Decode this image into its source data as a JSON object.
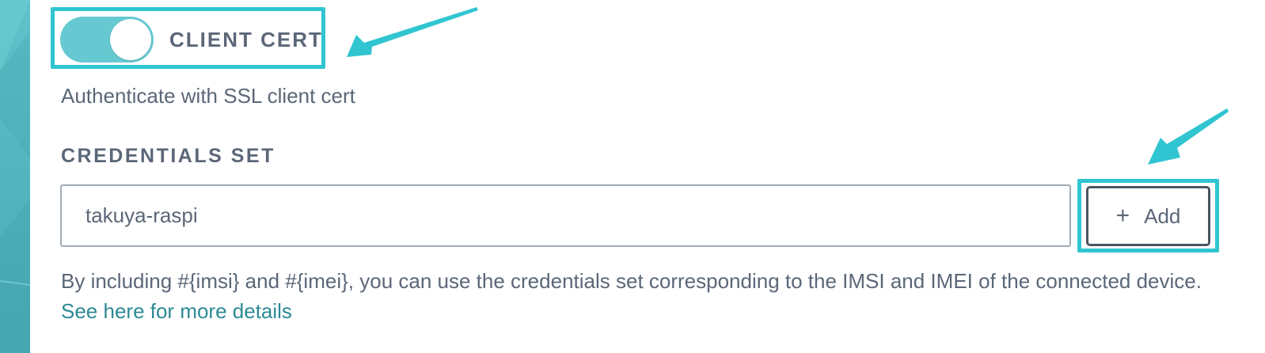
{
  "client_cert": {
    "label": "CLIENT CERT",
    "enabled": true,
    "description": "Authenticate with SSL client cert"
  },
  "credentials_set": {
    "title": "CREDENTIALS SET",
    "input_value": "takuya-raspi",
    "add_button_label": "Add",
    "help_text": "By including #{imsi} and #{imei}, you can use the credentials set corresponding to the IMSI and IMEI of the connected device.",
    "help_link_text": "See here for more details"
  },
  "icons": {
    "add": "plus-icon"
  },
  "colors": {
    "highlight": "#30c5d1",
    "toggle_on": "#66c9d2",
    "text": "#5b6778",
    "link": "#2c8a94",
    "sidebar": "#53b6c0"
  }
}
